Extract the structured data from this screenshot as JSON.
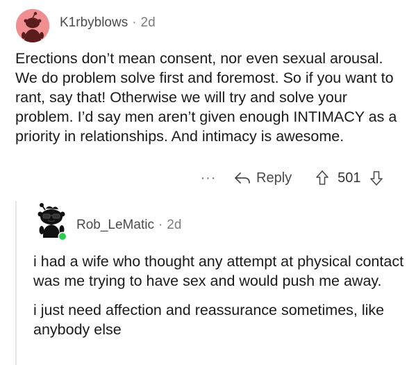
{
  "comment": {
    "username": "K1rbyblows",
    "separator": "·",
    "age": "2d",
    "avatar_icon": "snoo-avatar-icon",
    "body": "Erections don’t mean consent, nor even sexual arousal. We do problem solve first and foremost. So if you want to rant, say that! Otherwise we will try and solve your problem. I’d say men aren’t given enough INTIMACY as a priority in relationships. And intimacy is awesome.",
    "actions": {
      "more_label": "···",
      "reply_label": "Reply",
      "score": "501"
    }
  },
  "reply": {
    "username": "Rob_LeMatic",
    "separator": "·",
    "age": "2d",
    "avatar_icon": "snoo-sunglasses-avatar-icon",
    "online_status_color": "#2ecc52",
    "paragraphs": [
      "i had a wife who thought any attempt at physical contact was me trying to have sex and would push me away.",
      "i just need affection and reassurance sometimes, like anybody else"
    ]
  },
  "colors": {
    "avatar_bg": "#ef8f92",
    "text": "#1a1a1b",
    "meta": "#7c7c80"
  }
}
